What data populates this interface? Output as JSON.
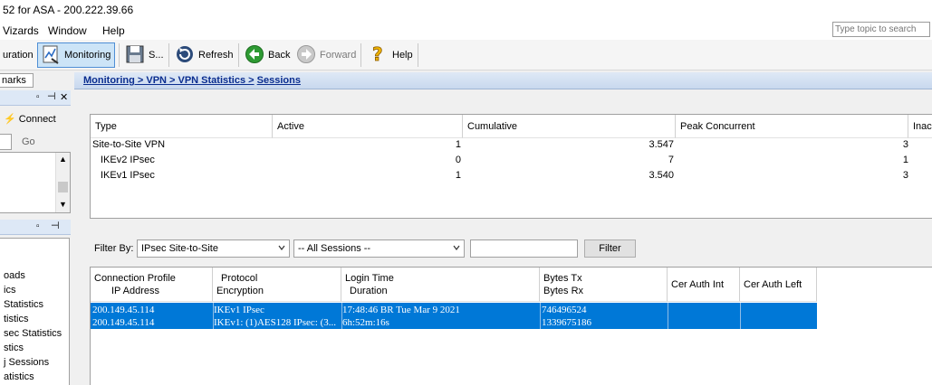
{
  "window": {
    "title": "52 for ASA - 200.222.39.66"
  },
  "menu": {
    "items": [
      "Vizards",
      "Window",
      "Help"
    ]
  },
  "search": {
    "placeholder": "Type topic to search"
  },
  "toolbar": {
    "configuration": "uration",
    "monitoring": "Monitoring",
    "save": "S...",
    "refresh": "Refresh",
    "back": "Back",
    "forward": "Forward",
    "help": "Help"
  },
  "left_panel": {
    "tab": "narks",
    "connect": "Connect",
    "go": "Go",
    "nav_items": [
      "oads",
      "ics",
      "Statistics",
      "tistics",
      "sec Statistics",
      "stics",
      "j Sessions",
      "atistics"
    ]
  },
  "breadcrumb": {
    "path": "Monitoring > VPN > VPN Statistics >",
    "current": "Sessions"
  },
  "summary": {
    "headers": [
      "Type",
      "Active",
      "Cumulative",
      "Peak Concurrent",
      "Inac"
    ],
    "rows": [
      {
        "type": "Site-to-Site VPN",
        "active": "1",
        "cumulative": "3.547",
        "peak": "3"
      },
      {
        "type": "IKEv2 IPsec",
        "active": "0",
        "cumulative": "7",
        "peak": "1"
      },
      {
        "type": "IKEv1 IPsec",
        "active": "1",
        "cumulative": "3.540",
        "peak": "3"
      }
    ]
  },
  "filter": {
    "label": "Filter By:",
    "type_value": "IPsec Site-to-Site",
    "sessions_value": "-- All Sessions --",
    "text_value": "",
    "button": "Filter"
  },
  "sessions": {
    "headers": {
      "profile": [
        "Connection Profile",
        "IP Address"
      ],
      "protocol": [
        "Protocol",
        "Encryption"
      ],
      "login": [
        "Login Time",
        "Duration"
      ],
      "bytes": [
        "Bytes Tx",
        "Bytes Rx"
      ],
      "auth_int": "Cer Auth Int",
      "auth_left": "Cer Auth Left"
    },
    "rows": [
      {
        "profile": "200.149.45.114",
        "ip": "200.149.45.114",
        "protocol": "IKEv1 IPsec",
        "encryption": "IKEv1: (1)AES128  IPsec: (3...",
        "login": "17:48:46 BR Tue Mar 9 2021",
        "duration": "6h:52m:16s",
        "tx": "746496524",
        "rx": "1339675186",
        "auth_int": "",
        "auth_left": ""
      }
    ]
  },
  "colors": {
    "selection": "#0078d7",
    "breadcrumb_text": "#0a2d8f",
    "header_bg": "#dde8f6"
  }
}
